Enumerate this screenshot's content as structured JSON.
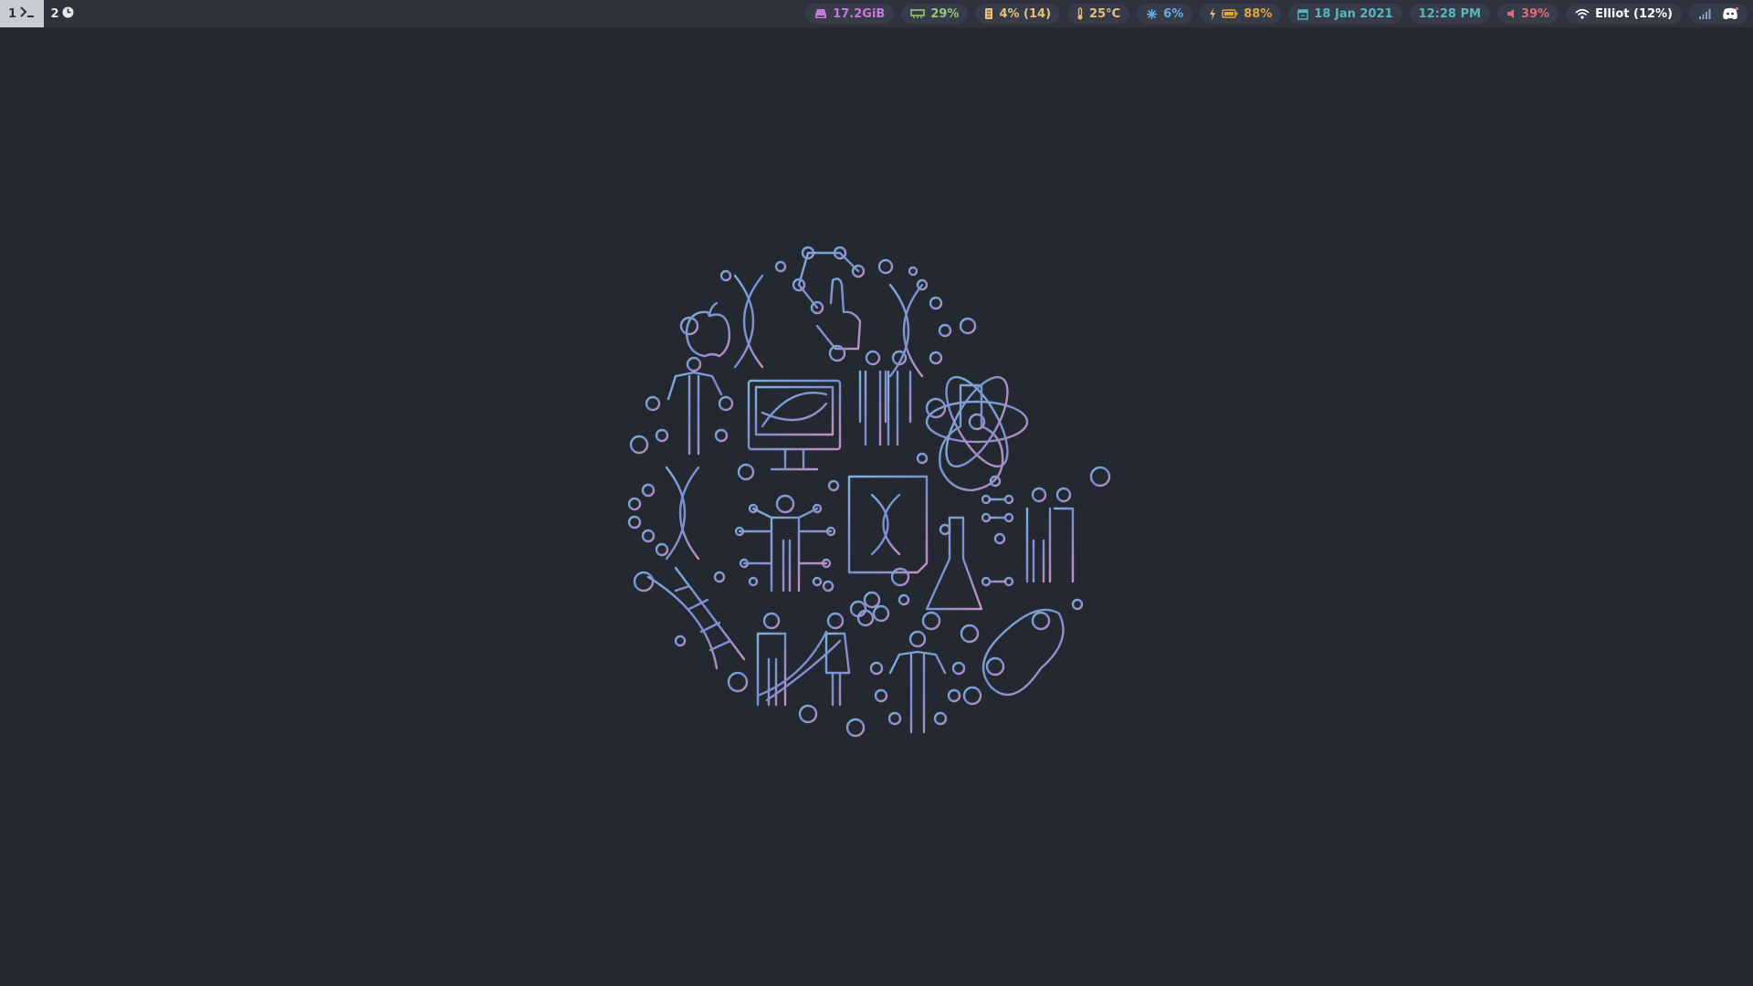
{
  "workspaces": [
    {
      "number": "1",
      "icon": "terminal-icon",
      "active": true
    },
    {
      "number": "2",
      "icon": "clock-icon",
      "active": false
    }
  ],
  "modules": {
    "disk": {
      "text": "17.2GiB",
      "icon": "disk-icon",
      "color": "#c679dd"
    },
    "memory": {
      "text": "29%",
      "icon": "memory-icon",
      "color": "#98c379"
    },
    "cpu": {
      "text": "4% (14)",
      "icon": "cpu-icon",
      "color": "#e5c07b"
    },
    "temperature": {
      "text": "25°C",
      "icon": "thermometer-icon",
      "color": "#e5c07b"
    },
    "fan": {
      "text": "6%",
      "icon": "fan-icon",
      "color": "#61afef"
    },
    "battery": {
      "text": "88%",
      "icon": "battery-icon",
      "color": "#e5a53b"
    },
    "date": {
      "text": "18 Jan 2021",
      "icon": "calendar-icon",
      "color": "#56b6c2"
    },
    "time": {
      "text": "12:28 PM",
      "color": "#56b6c2"
    },
    "volume": {
      "text": "39%",
      "icon": "speaker-icon",
      "color": "#e06c75"
    },
    "wifi": {
      "text": "Elliot (12%)",
      "icon": "wifi-icon",
      "color": "#ffffff"
    }
  },
  "tray": [
    {
      "icon": "signal-bars-icon",
      "color": "#8aa0c8"
    },
    {
      "icon": "discord-icon",
      "color": "#ffffff"
    }
  ],
  "wallpaper": {
    "description_icon": "science-dna-illustration-icon",
    "gradient": [
      "#7fb0d8",
      "#7a8fd0",
      "#c58fbf"
    ]
  }
}
